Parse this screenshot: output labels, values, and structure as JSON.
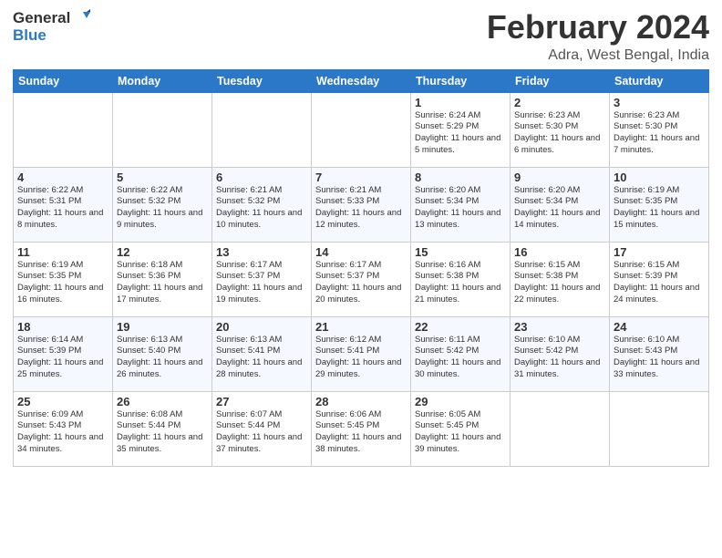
{
  "logo": {
    "general": "General",
    "blue": "Blue"
  },
  "header": {
    "month": "February 2024",
    "location": "Adra, West Bengal, India"
  },
  "weekdays": [
    "Sunday",
    "Monday",
    "Tuesday",
    "Wednesday",
    "Thursday",
    "Friday",
    "Saturday"
  ],
  "weeks": [
    [
      {
        "day": "",
        "info": ""
      },
      {
        "day": "",
        "info": ""
      },
      {
        "day": "",
        "info": ""
      },
      {
        "day": "",
        "info": ""
      },
      {
        "day": "1",
        "info": "Sunrise: 6:24 AM\nSunset: 5:29 PM\nDaylight: 11 hours and 5 minutes."
      },
      {
        "day": "2",
        "info": "Sunrise: 6:23 AM\nSunset: 5:30 PM\nDaylight: 11 hours and 6 minutes."
      },
      {
        "day": "3",
        "info": "Sunrise: 6:23 AM\nSunset: 5:30 PM\nDaylight: 11 hours and 7 minutes."
      }
    ],
    [
      {
        "day": "4",
        "info": "Sunrise: 6:22 AM\nSunset: 5:31 PM\nDaylight: 11 hours and 8 minutes."
      },
      {
        "day": "5",
        "info": "Sunrise: 6:22 AM\nSunset: 5:32 PM\nDaylight: 11 hours and 9 minutes."
      },
      {
        "day": "6",
        "info": "Sunrise: 6:21 AM\nSunset: 5:32 PM\nDaylight: 11 hours and 10 minutes."
      },
      {
        "day": "7",
        "info": "Sunrise: 6:21 AM\nSunset: 5:33 PM\nDaylight: 11 hours and 12 minutes."
      },
      {
        "day": "8",
        "info": "Sunrise: 6:20 AM\nSunset: 5:34 PM\nDaylight: 11 hours and 13 minutes."
      },
      {
        "day": "9",
        "info": "Sunrise: 6:20 AM\nSunset: 5:34 PM\nDaylight: 11 hours and 14 minutes."
      },
      {
        "day": "10",
        "info": "Sunrise: 6:19 AM\nSunset: 5:35 PM\nDaylight: 11 hours and 15 minutes."
      }
    ],
    [
      {
        "day": "11",
        "info": "Sunrise: 6:19 AM\nSunset: 5:35 PM\nDaylight: 11 hours and 16 minutes."
      },
      {
        "day": "12",
        "info": "Sunrise: 6:18 AM\nSunset: 5:36 PM\nDaylight: 11 hours and 17 minutes."
      },
      {
        "day": "13",
        "info": "Sunrise: 6:17 AM\nSunset: 5:37 PM\nDaylight: 11 hours and 19 minutes."
      },
      {
        "day": "14",
        "info": "Sunrise: 6:17 AM\nSunset: 5:37 PM\nDaylight: 11 hours and 20 minutes."
      },
      {
        "day": "15",
        "info": "Sunrise: 6:16 AM\nSunset: 5:38 PM\nDaylight: 11 hours and 21 minutes."
      },
      {
        "day": "16",
        "info": "Sunrise: 6:15 AM\nSunset: 5:38 PM\nDaylight: 11 hours and 22 minutes."
      },
      {
        "day": "17",
        "info": "Sunrise: 6:15 AM\nSunset: 5:39 PM\nDaylight: 11 hours and 24 minutes."
      }
    ],
    [
      {
        "day": "18",
        "info": "Sunrise: 6:14 AM\nSunset: 5:39 PM\nDaylight: 11 hours and 25 minutes."
      },
      {
        "day": "19",
        "info": "Sunrise: 6:13 AM\nSunset: 5:40 PM\nDaylight: 11 hours and 26 minutes."
      },
      {
        "day": "20",
        "info": "Sunrise: 6:13 AM\nSunset: 5:41 PM\nDaylight: 11 hours and 28 minutes."
      },
      {
        "day": "21",
        "info": "Sunrise: 6:12 AM\nSunset: 5:41 PM\nDaylight: 11 hours and 29 minutes."
      },
      {
        "day": "22",
        "info": "Sunrise: 6:11 AM\nSunset: 5:42 PM\nDaylight: 11 hours and 30 minutes."
      },
      {
        "day": "23",
        "info": "Sunrise: 6:10 AM\nSunset: 5:42 PM\nDaylight: 11 hours and 31 minutes."
      },
      {
        "day": "24",
        "info": "Sunrise: 6:10 AM\nSunset: 5:43 PM\nDaylight: 11 hours and 33 minutes."
      }
    ],
    [
      {
        "day": "25",
        "info": "Sunrise: 6:09 AM\nSunset: 5:43 PM\nDaylight: 11 hours and 34 minutes."
      },
      {
        "day": "26",
        "info": "Sunrise: 6:08 AM\nSunset: 5:44 PM\nDaylight: 11 hours and 35 minutes."
      },
      {
        "day": "27",
        "info": "Sunrise: 6:07 AM\nSunset: 5:44 PM\nDaylight: 11 hours and 37 minutes."
      },
      {
        "day": "28",
        "info": "Sunrise: 6:06 AM\nSunset: 5:45 PM\nDaylight: 11 hours and 38 minutes."
      },
      {
        "day": "29",
        "info": "Sunrise: 6:05 AM\nSunset: 5:45 PM\nDaylight: 11 hours and 39 minutes."
      },
      {
        "day": "",
        "info": ""
      },
      {
        "day": "",
        "info": ""
      }
    ]
  ]
}
